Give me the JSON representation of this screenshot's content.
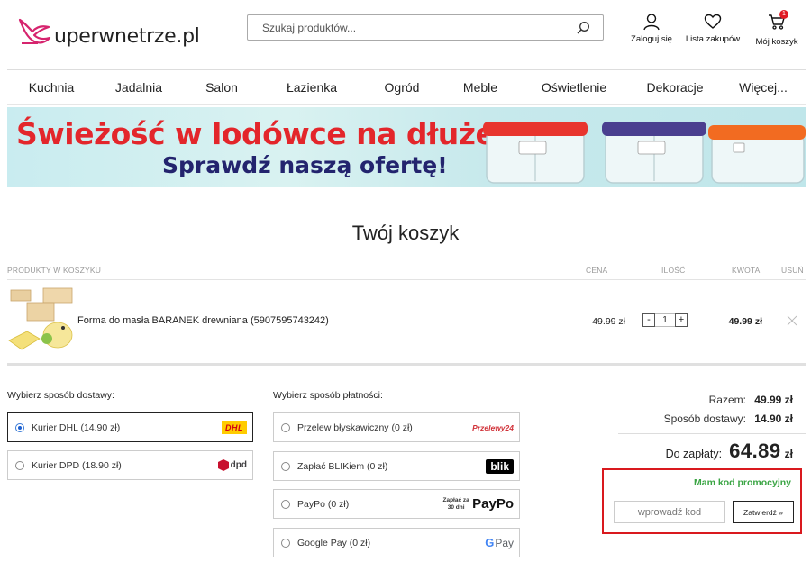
{
  "header": {
    "logo_text": "uperwnetrze.pl",
    "search_placeholder": "Szukaj produktów...",
    "account_label": "Zaloguj się",
    "wishlist_label": "Lista zakupów",
    "cart_label": "Mój koszyk",
    "cart_count": "1",
    "icons": [
      "search-icon",
      "user-icon",
      "heart-icon",
      "cart-icon"
    ]
  },
  "nav": {
    "items": [
      {
        "label": "Kuchnia"
      },
      {
        "label": "Jadalnia"
      },
      {
        "label": "Salon"
      },
      {
        "label": "Łazienka"
      },
      {
        "label": "Ogród"
      },
      {
        "label": "Meble"
      },
      {
        "label": "Oświetlenie"
      },
      {
        "label": "Dekoracje"
      },
      {
        "label": "Więcej..."
      }
    ]
  },
  "banner": {
    "headline": "Świeżość w lodówce na dłużej!",
    "subline": "Sprawdź naszą ofertę!",
    "lid_colors": [
      "#e8352e",
      "#4a3f8f",
      "#f26b21"
    ]
  },
  "cart": {
    "title": "Twój koszyk",
    "columns": {
      "products": "PRODUKTY W KOSZYKU",
      "price": "CENA",
      "qty": "ILOŚĆ",
      "amount": "KWOTA",
      "remove": "USUŃ"
    },
    "items": [
      {
        "name": "Forma do masła BARANEK drewniana (5907595743242)",
        "price": "49.99 zł",
        "qty": "1",
        "total": "49.99 zł"
      }
    ],
    "qty_minus": "-",
    "qty_plus": "+"
  },
  "delivery": {
    "title": "Wybierz sposób dostawy:",
    "options": [
      {
        "label": "Kurier DHL (14.90 zł)",
        "logo": "DHL",
        "selected": true
      },
      {
        "label": "Kurier DPD (18.90 zł)",
        "logo": "dpd",
        "selected": false
      }
    ]
  },
  "payment": {
    "title": "Wybierz sposób płatności:",
    "options": [
      {
        "label": "Przelew błyskawiczny (0 zł)",
        "logo": "Przelewy24"
      },
      {
        "label": "Zapłać BLIKiem (0 zł)",
        "logo": "blik"
      },
      {
        "label": "PayPo (0 zł)",
        "logo_small": "Zapłać za 30 dni",
        "logo": "PayPo"
      },
      {
        "label": "Google Pay (0 zł)",
        "logo": "Pay"
      }
    ]
  },
  "summary": {
    "subtotal_label": "Razem:",
    "subtotal_value": "49.99 zł",
    "shipping_label": "Sposób dostawy:",
    "shipping_value": "14.90 zł",
    "total_label": "Do zapłaty:",
    "total_value": "64.89",
    "currency": "zł"
  },
  "promo": {
    "title": "Mam kod promocyjny",
    "placeholder": "wprowadź kod",
    "button": "Zatwierdź »",
    "highlight_color": "#d9191e"
  },
  "colors": {
    "accent_red": "#e3262b",
    "promo_green": "#3aa544",
    "logo_pink": "#d6246e"
  }
}
